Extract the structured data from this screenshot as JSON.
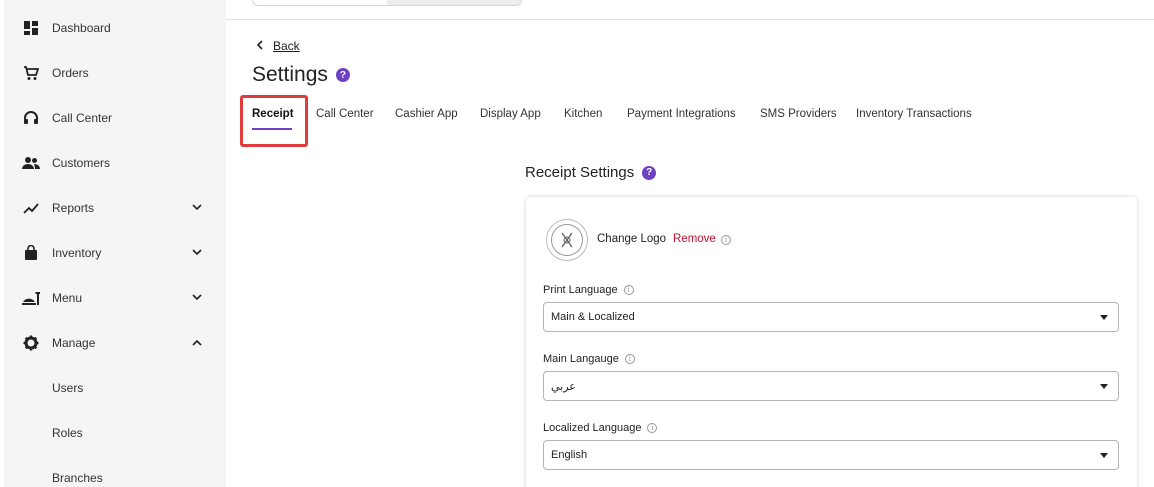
{
  "sidebar": {
    "items": [
      {
        "label": "Dashboard"
      },
      {
        "label": "Orders"
      },
      {
        "label": "Call Center"
      },
      {
        "label": "Customers"
      },
      {
        "label": "Reports"
      },
      {
        "label": "Inventory"
      },
      {
        "label": "Menu"
      },
      {
        "label": "Manage"
      },
      {
        "label": "Users"
      },
      {
        "label": "Roles"
      },
      {
        "label": "Branches"
      }
    ]
  },
  "header": {
    "back_label": "Back",
    "title": "Settings",
    "help_glyph": "?"
  },
  "tabs": [
    {
      "label": "Receipt"
    },
    {
      "label": "Call Center"
    },
    {
      "label": "Cashier App"
    },
    {
      "label": "Display App"
    },
    {
      "label": "Kitchen"
    },
    {
      "label": "Payment Integrations"
    },
    {
      "label": "SMS Providers"
    },
    {
      "label": "Inventory Transactions"
    }
  ],
  "receipt": {
    "section_title": "Receipt Settings",
    "help_glyph": "?",
    "change_logo_label": "Change Logo",
    "remove_label": "Remove",
    "fields": [
      {
        "label": "Print Language",
        "value": "Main & Localized"
      },
      {
        "label": "Main Langauge",
        "value": "عربي"
      },
      {
        "label": "Localized Language",
        "value": "English"
      }
    ]
  },
  "colors": {
    "accent": "#6f42c1",
    "danger": "#c8102e",
    "highlight": "#e03c3c",
    "sidebar_bg": "#f5f5f5"
  }
}
